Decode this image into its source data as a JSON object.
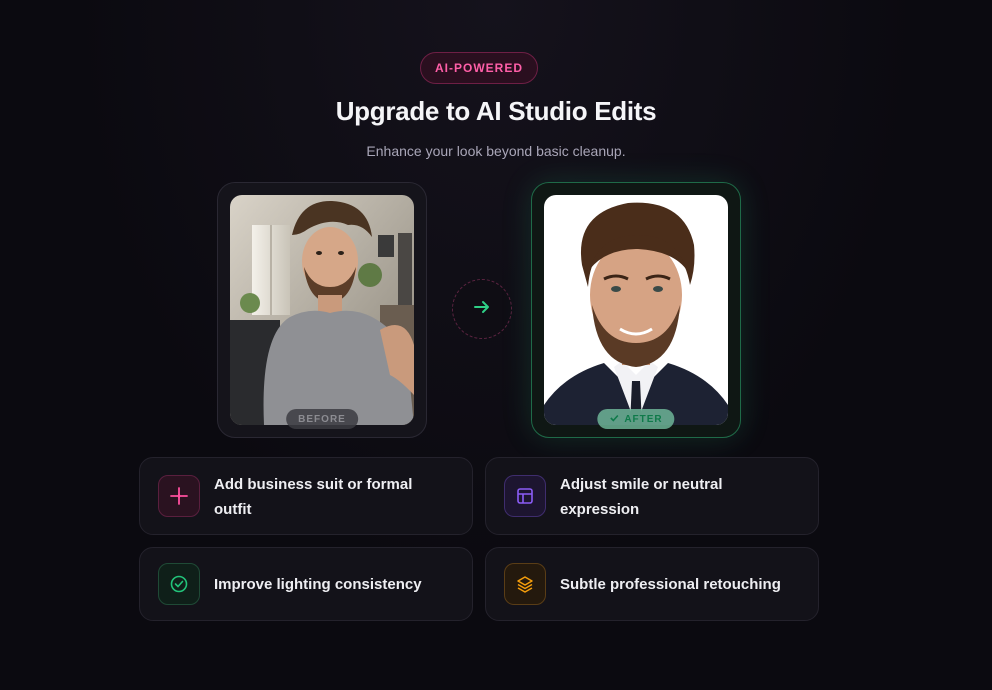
{
  "header": {
    "badge": "AI-POWERED",
    "title": "Upgrade to AI Studio Edits",
    "subtitle": "Enhance your look beyond basic cleanup."
  },
  "comparison": {
    "before_label": "BEFORE",
    "after_label": "AFTER",
    "arrow_icon": "arrow-right-icon"
  },
  "features": [
    {
      "label": "Add business suit or formal outfit",
      "icon": "sparkle-icon",
      "color": "#ff4f9e"
    },
    {
      "label": "Adjust smile or neutral expression",
      "icon": "layout-icon",
      "color": "#8b5cf6"
    },
    {
      "label": "Improve lighting consistency",
      "icon": "check-circle-icon",
      "color": "#22c37a"
    },
    {
      "label": "Subtle professional retouching",
      "icon": "layers-icon",
      "color": "#f59e0b"
    }
  ],
  "colors": {
    "background": "#0b0a10",
    "accent_pink": "#ff5fa8",
    "accent_green": "#22c37a"
  }
}
